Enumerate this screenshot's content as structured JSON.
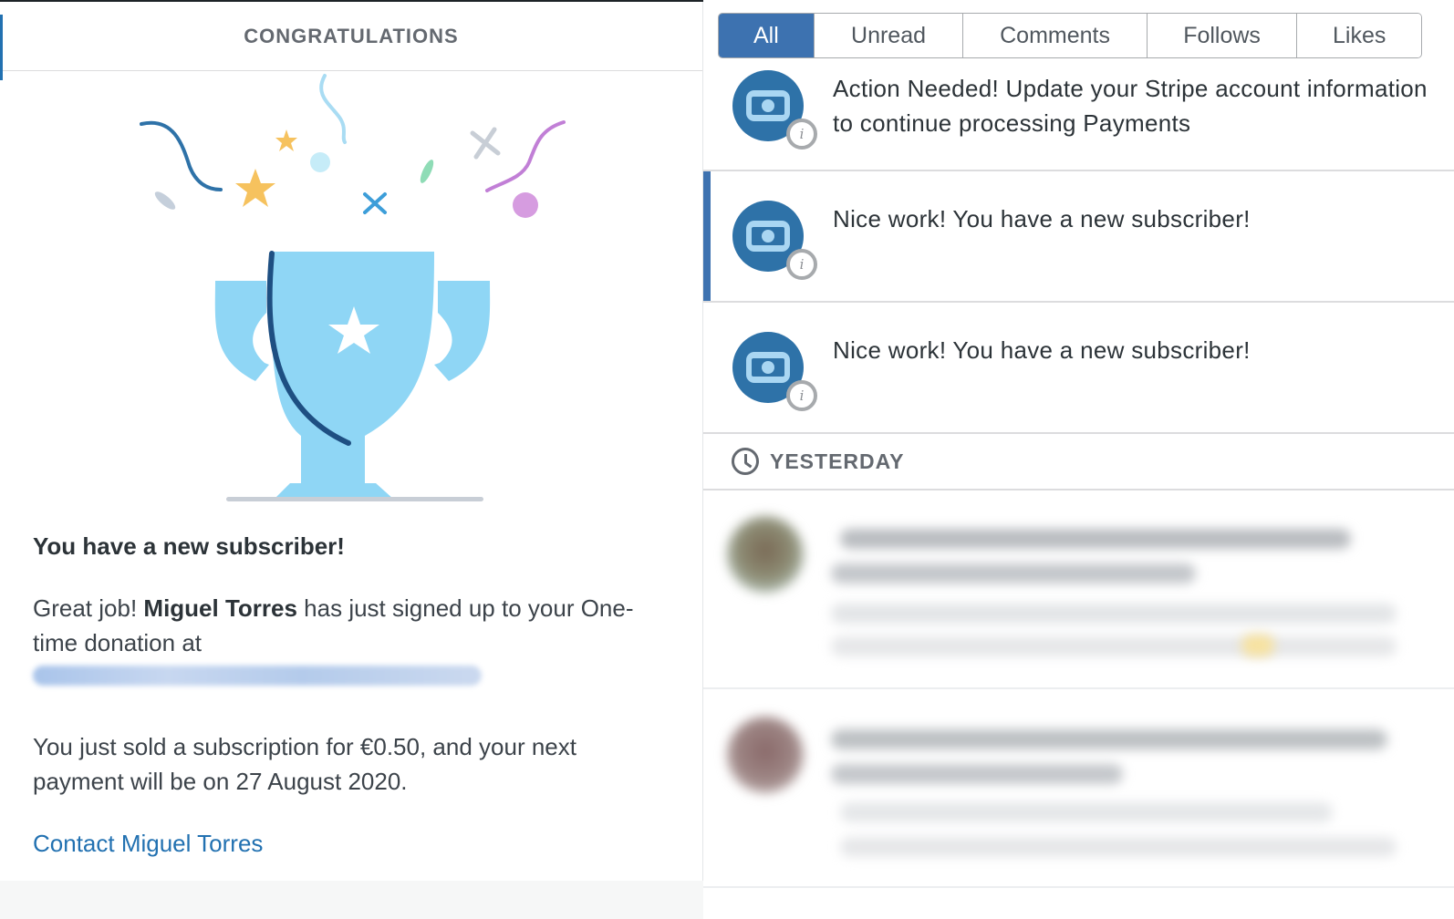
{
  "congrats_panel": {
    "title": "CONGRATULATIONS",
    "heading": "You have a new subscriber!",
    "body_prefix": "Great job! ",
    "subscriber_name": "Miguel Torres",
    "body_suffix": " has just signed up to your One-time donation at",
    "sale_text": "You just sold a subscription for €0.50, and your next payment will be on 27 August 2020.",
    "contact_link": "Contact Miguel Torres"
  },
  "tabs": [
    {
      "label": "All",
      "active": true
    },
    {
      "label": "Unread",
      "active": false
    },
    {
      "label": "Comments",
      "active": false
    },
    {
      "label": "Follows",
      "active": false
    },
    {
      "label": "Likes",
      "active": false
    }
  ],
  "notifications": [
    {
      "icon": "money-icon",
      "text": "Action Needed! Update your Stripe account information to continue processing Payments",
      "selected": false
    },
    {
      "icon": "money-icon",
      "text": "Nice work! You have a new subscriber!",
      "selected": true
    },
    {
      "icon": "money-icon",
      "text": "Nice work! You have a new subscriber!",
      "selected": false
    }
  ],
  "section": {
    "label": "YESTERDAY",
    "icon": "clock-icon"
  },
  "colors": {
    "accent": "#3d72b0",
    "link": "#2271b1",
    "trophy": "#8fd6f5",
    "avatar": "#2e72a8"
  }
}
